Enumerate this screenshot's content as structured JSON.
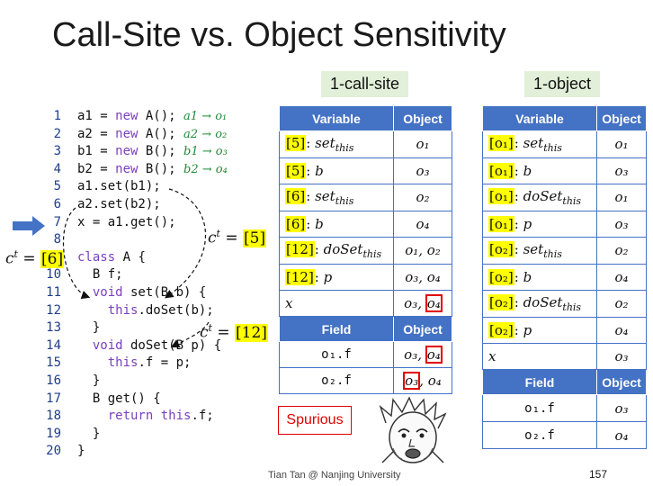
{
  "title": "Call-Site vs. Object Sensitivity",
  "code": [
    {
      "n": "1",
      "parts": [
        [
          "tx",
          "a1 = "
        ],
        [
          "kw",
          "new"
        ],
        [
          "tx",
          " A(); "
        ],
        [
          "cm",
          "a1 → o₁"
        ]
      ]
    },
    {
      "n": "2",
      "parts": [
        [
          "tx",
          "a2 = "
        ],
        [
          "kw",
          "new"
        ],
        [
          "tx",
          " A(); "
        ],
        [
          "cm",
          "a2 → o₂"
        ]
      ]
    },
    {
      "n": "3",
      "parts": [
        [
          "tx",
          "b1 = "
        ],
        [
          "kw",
          "new"
        ],
        [
          "tx",
          " B(); "
        ],
        [
          "cm",
          "b1 → o₃"
        ]
      ]
    },
    {
      "n": "4",
      "parts": [
        [
          "tx",
          "b2 = "
        ],
        [
          "kw",
          "new"
        ],
        [
          "tx",
          " B(); "
        ],
        [
          "cm",
          "b2 → o₄"
        ]
      ]
    },
    {
      "n": "5",
      "parts": [
        [
          "tx",
          "a1.set(b1);"
        ]
      ]
    },
    {
      "n": "6",
      "parts": [
        [
          "tx",
          "a2.set(b2);"
        ]
      ]
    },
    {
      "n": "7",
      "parts": [
        [
          "tx",
          "x = a1.get();"
        ]
      ]
    },
    {
      "n": "8",
      "parts": [
        [
          "tx",
          ""
        ]
      ]
    },
    {
      "n": "9",
      "parts": [
        [
          "kw",
          "class"
        ],
        [
          "tx",
          " A {"
        ]
      ]
    },
    {
      "n": "10",
      "parts": [
        [
          "tx",
          "  B f;"
        ]
      ]
    },
    {
      "n": "11",
      "parts": [
        [
          "tx",
          "  "
        ],
        [
          "kw",
          "void"
        ],
        [
          "tx",
          " set(B b) {"
        ]
      ]
    },
    {
      "n": "12",
      "parts": [
        [
          "tx",
          "    "
        ],
        [
          "kw",
          "this"
        ],
        [
          "tx",
          ".doSet(b);"
        ]
      ]
    },
    {
      "n": "13",
      "parts": [
        [
          "tx",
          "  }"
        ]
      ]
    },
    {
      "n": "14",
      "parts": [
        [
          "tx",
          "  "
        ],
        [
          "kw",
          "void"
        ],
        [
          "tx",
          " doSet(B p) {"
        ]
      ]
    },
    {
      "n": "15",
      "parts": [
        [
          "tx",
          "    "
        ],
        [
          "kw",
          "this"
        ],
        [
          "tx",
          ".f = p;"
        ]
      ]
    },
    {
      "n": "16",
      "parts": [
        [
          "tx",
          "  }"
        ]
      ]
    },
    {
      "n": "17",
      "parts": [
        [
          "tx",
          "  B get() {"
        ]
      ]
    },
    {
      "n": "18",
      "parts": [
        [
          "tx",
          "    "
        ],
        [
          "kw",
          "return this"
        ],
        [
          "tx",
          ".f;"
        ]
      ]
    },
    {
      "n": "19",
      "parts": [
        [
          "tx",
          "  }"
        ]
      ]
    },
    {
      "n": "20",
      "parts": [
        [
          "tx",
          "}"
        ]
      ]
    }
  ],
  "ct_labels": {
    "left": {
      "prefix": "c",
      "sup": "t",
      "eq": " = ",
      "ctx": "[6]"
    },
    "mid": {
      "prefix": "c",
      "sup": "t",
      "eq": " = ",
      "ctx": "[5]"
    },
    "low": {
      "prefix": "c",
      "sup": "t",
      "eq": " = ",
      "ctx": "[12]"
    }
  },
  "call_site": {
    "label": "1-call-site",
    "var_headers": [
      "Variable",
      "Object"
    ],
    "rows": [
      {
        "ctx": "[5]",
        "var": "set",
        "sub": "this",
        "obj": "o₁"
      },
      {
        "ctx": "[5]",
        "var": "b",
        "sub": "",
        "obj": "o₃"
      },
      {
        "ctx": "[6]",
        "var": "set",
        "sub": "this",
        "obj": "o₂"
      },
      {
        "ctx": "[6]",
        "var": "b",
        "sub": "",
        "obj": "o₄"
      },
      {
        "ctx": "[12]",
        "var": "doSet",
        "sub": "this",
        "obj": "o₁, o₂"
      },
      {
        "ctx": "[12]",
        "var": "p",
        "sub": "",
        "obj": "o₃, o₄"
      }
    ],
    "x_row": {
      "var": "x",
      "obj_a": "o₃",
      "obj_b": "o₄"
    },
    "field_headers": [
      "Field",
      "Object"
    ],
    "fields": [
      {
        "field": "o₁.f",
        "obj_plain": "o₃",
        "obj_boxed": "o₄",
        "boxed_first": false
      },
      {
        "field": "o₂.f",
        "obj_plain": "o₄",
        "obj_boxed": "o₃",
        "boxed_first": true
      }
    ]
  },
  "object": {
    "label": "1-object",
    "var_headers": [
      "Variable",
      "Object"
    ],
    "rows": [
      {
        "ctx": "[o₁]",
        "var": "set",
        "sub": "this",
        "obj": "o₁"
      },
      {
        "ctx": "[o₁]",
        "var": "b",
        "sub": "",
        "obj": "o₃"
      },
      {
        "ctx": "[o₁]",
        "var": "doSet",
        "sub": "this",
        "obj": "o₁"
      },
      {
        "ctx": "[o₁]",
        "var": "p",
        "sub": "",
        "obj": "o₃"
      },
      {
        "ctx": "[o₂]",
        "var": "set",
        "sub": "this",
        "obj": "o₂"
      },
      {
        "ctx": "[o₂]",
        "var": "b",
        "sub": "",
        "obj": "o₄"
      },
      {
        "ctx": "[o₂]",
        "var": "doSet",
        "sub": "this",
        "obj": "o₂"
      },
      {
        "ctx": "[o₂]",
        "var": "p",
        "sub": "",
        "obj": "o₄"
      }
    ],
    "x_row": {
      "var": "x",
      "obj": "o₃"
    },
    "field_headers": [
      "Field",
      "Object"
    ],
    "fields": [
      {
        "field": "o₁.f",
        "obj": "o₃"
      },
      {
        "field": "o₂.f",
        "obj": "o₄"
      }
    ]
  },
  "spurious": "Spurious",
  "footer": "Tian Tan @ Nanjing University",
  "page_number": "157",
  "colors": {
    "header_blue": "#4472c4",
    "label_green": "#e2efd9",
    "highlight": "#ffff00",
    "spurious_red": "#e00000"
  }
}
